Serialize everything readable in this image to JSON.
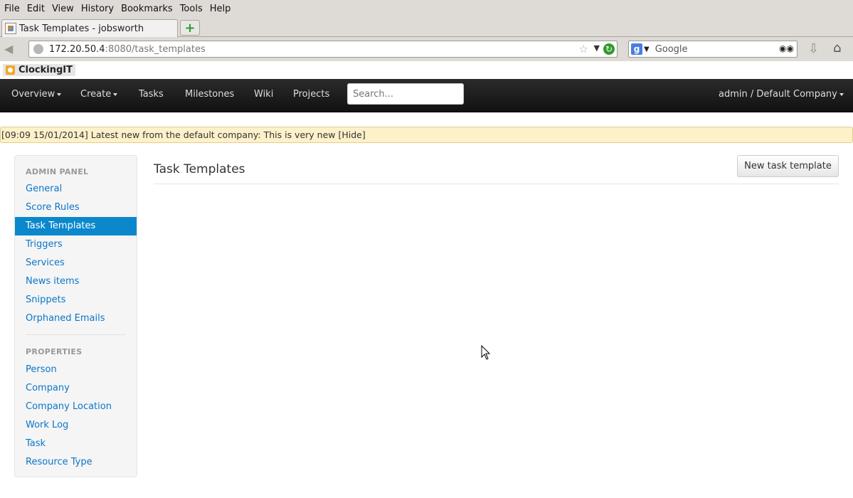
{
  "browser": {
    "menu": [
      "File",
      "Edit",
      "View",
      "History",
      "Bookmarks",
      "Tools",
      "Help"
    ],
    "tab_title": "Task Templates - jobsworth",
    "url_host": "172.20.50.4",
    "url_rest": ":8080/task_templates",
    "search_placeholder": "Google",
    "bookmark": "ClockingIT"
  },
  "appnav": {
    "overview": "Overview",
    "create": "Create",
    "tasks": "Tasks",
    "milestones": "Milestones",
    "wiki": "Wiki",
    "projects": "Projects",
    "search_placeholder": "Search...",
    "user": "admin / Default Company"
  },
  "news": "[09:09 15/01/2014] Latest new from the default company: This is very new [Hide]",
  "sidebar": {
    "admin_header": "ADMIN PANEL",
    "admin_items": [
      "General",
      "Score Rules",
      "Task Templates",
      "Triggers",
      "Services",
      "News items",
      "Snippets",
      "Orphaned Emails"
    ],
    "properties_header": "PROPERTIES",
    "property_items": [
      "Person",
      "Company",
      "Company Location",
      "Work Log",
      "Task",
      "Resource Type"
    ]
  },
  "main": {
    "title": "Task Templates",
    "new_button": "New task template"
  }
}
